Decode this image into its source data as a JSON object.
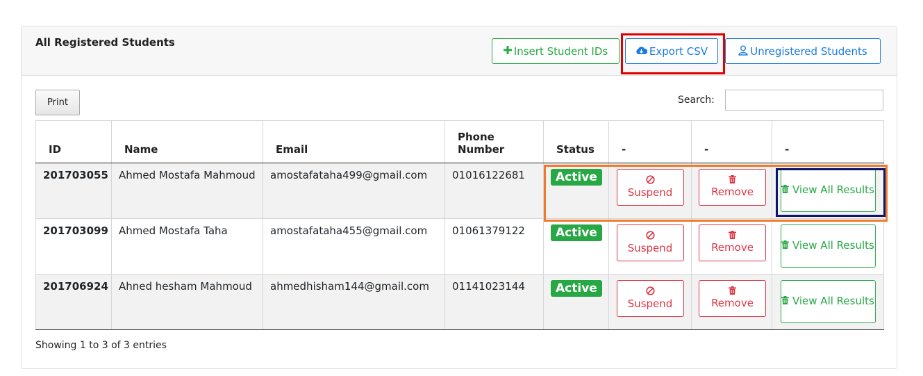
{
  "header": {
    "title": "All Registered Students",
    "buttons": {
      "insert": {
        "icon": "plus-icon",
        "label": "Insert Student IDs"
      },
      "export": {
        "icon": "cloud-download-icon",
        "label": "Export CSV"
      },
      "unregistered": {
        "icon": "user-icon",
        "label": "Unregistered Students"
      }
    }
  },
  "toolbar": {
    "print_label": "Print",
    "search_label": "Search:",
    "search_value": ""
  },
  "table": {
    "columns": [
      "ID",
      "Name",
      "Email",
      "Phone Number",
      "Status",
      "-",
      "-",
      "-"
    ],
    "rows": [
      {
        "id": "201703055",
        "name": "Ahmed Mostafa Mahmoud",
        "email": "amostafataha499@gmail.com",
        "phone": "01016122681",
        "status": "Active",
        "suspend": "Suspend",
        "remove": "Remove",
        "view": "View All Results"
      },
      {
        "id": "201703099",
        "name": "Ahmed Mostafa Taha",
        "email": "amostafataha455@gmail.com",
        "phone": "01061379122",
        "status": "Active",
        "suspend": "Suspend",
        "remove": "Remove",
        "view": "View All Results"
      },
      {
        "id": "201706924",
        "name": "Ahned hesham Mahmoud",
        "email": "ahmedhisham144@gmail.com",
        "phone": "01141023144",
        "status": "Active",
        "suspend": "Suspend",
        "remove": "Remove",
        "view": "View All Results"
      }
    ]
  },
  "footer": {
    "info": "Showing 1 to 3 of 3 entries"
  },
  "colors": {
    "success": "#28a745",
    "danger": "#dc3545",
    "primary": "#1a7be0",
    "highlight_red": "#e00000",
    "highlight_orange": "#f07a2a",
    "highlight_navy": "#0a1670"
  }
}
